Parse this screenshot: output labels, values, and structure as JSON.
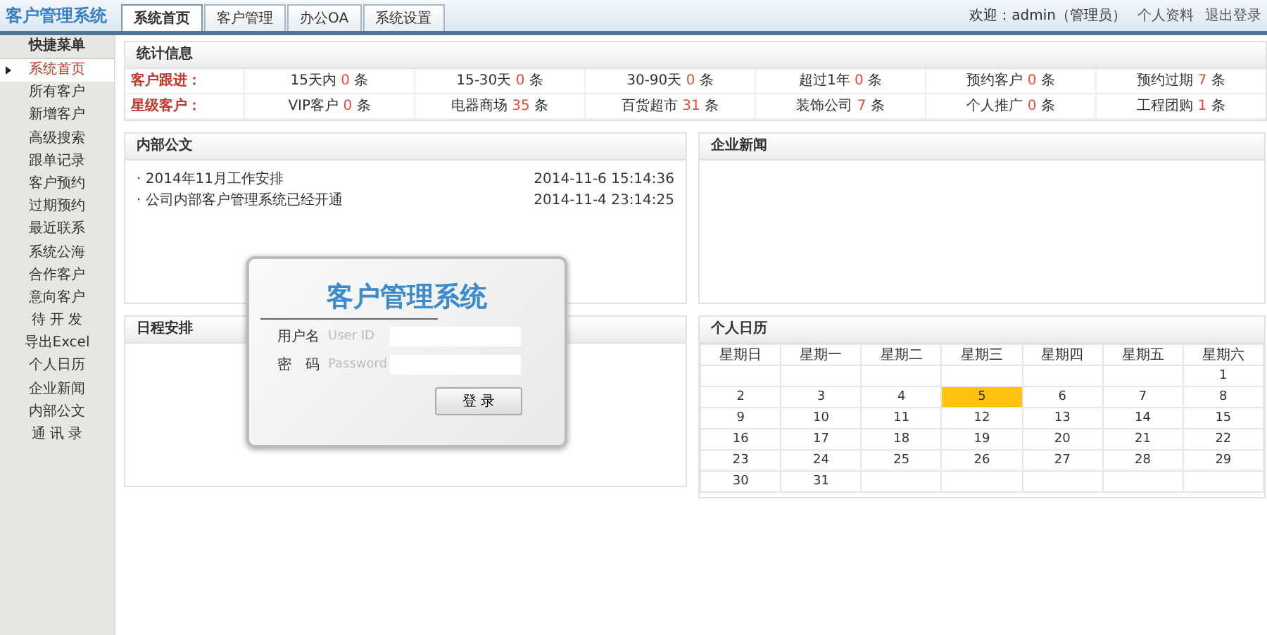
{
  "header": {
    "logo": "客户管理系统",
    "tabs": [
      {
        "label": "系统首页",
        "selected": true
      },
      {
        "label": "客户管理",
        "selected": false
      },
      {
        "label": "办公OA",
        "selected": false
      },
      {
        "label": "系统设置",
        "selected": false
      }
    ],
    "welcome": "欢迎：admin（管理员）",
    "links": [
      "个人资料",
      "退出登录"
    ]
  },
  "sidebar": {
    "title": "快捷菜单",
    "items": [
      {
        "label": "系统首页",
        "selected": true
      },
      {
        "label": "所有客户",
        "selected": false
      },
      {
        "label": "新增客户",
        "selected": false
      },
      {
        "label": "高级搜索",
        "selected": false
      },
      {
        "label": "跟单记录",
        "selected": false
      },
      {
        "label": "客户预约",
        "selected": false
      },
      {
        "label": "过期预约",
        "selected": false
      },
      {
        "label": "最近联系",
        "selected": false
      },
      {
        "label": "系统公海",
        "selected": false
      },
      {
        "label": "合作客户",
        "selected": false
      },
      {
        "label": "意向客户",
        "selected": false
      },
      {
        "label": "待 开 发",
        "selected": false
      },
      {
        "label": "导出Excel",
        "selected": false
      },
      {
        "label": "个人日历",
        "selected": false
      },
      {
        "label": "企业新闻",
        "selected": false
      },
      {
        "label": "内部公文",
        "selected": false
      },
      {
        "label": "通 讯 录",
        "selected": false
      }
    ]
  },
  "stats": {
    "title": "统计信息",
    "rows": [
      {
        "label": "客户跟进：",
        "cells": [
          {
            "label": "15天内",
            "count": "0",
            "unit": "条"
          },
          {
            "label": "15-30天",
            "count": "0",
            "unit": "条"
          },
          {
            "label": "30-90天",
            "count": "0",
            "unit": "条"
          },
          {
            "label": "超过1年",
            "count": "0",
            "unit": "条"
          },
          {
            "label": "预约客户",
            "count": "0",
            "unit": "条"
          },
          {
            "label": "预约过期",
            "count": "7",
            "unit": "条"
          }
        ]
      },
      {
        "label": "星级客户：",
        "cells": [
          {
            "label": "VIP客户",
            "count": "0",
            "unit": "条"
          },
          {
            "label": "电器商场",
            "count": "35",
            "unit": "条"
          },
          {
            "label": "百货超市",
            "count": "31",
            "unit": "条"
          },
          {
            "label": "装饰公司",
            "count": "7",
            "unit": "条"
          },
          {
            "label": "个人推广",
            "count": "0",
            "unit": "条"
          },
          {
            "label": "工程团购",
            "count": "1",
            "unit": "条"
          }
        ]
      }
    ]
  },
  "notices": {
    "title": "内部公文",
    "items": [
      {
        "title": "· 2014年11月工作安排",
        "time": "2014-11-6 15:14:36"
      },
      {
        "title": "· 公司内部客户管理系统已经开通",
        "time": "2014-11-4 23:14:25"
      }
    ]
  },
  "news": {
    "title": "企业新闻"
  },
  "schedule": {
    "title": "日程安排"
  },
  "calendar": {
    "title": "个人日历",
    "weekdays": [
      "星期日",
      "星期一",
      "星期二",
      "星期三",
      "星期四",
      "星期五",
      "星期六"
    ],
    "weeks": [
      [
        {
          "kind": "blank"
        },
        {
          "kind": "blank"
        },
        {
          "kind": "blank"
        },
        {
          "kind": "blank"
        },
        {
          "kind": "blank"
        },
        {
          "kind": "blank"
        },
        {
          "day": "1",
          "selected": false
        }
      ],
      [
        {
          "day": "2",
          "selected": false
        },
        {
          "day": "3",
          "selected": false
        },
        {
          "day": "4",
          "selected": false
        },
        {
          "day": "5",
          "selected": true
        },
        {
          "day": "6",
          "selected": false
        },
        {
          "day": "7",
          "selected": false
        },
        {
          "day": "8",
          "selected": false
        }
      ],
      [
        {
          "day": "9",
          "selected": false
        },
        {
          "day": "10",
          "selected": false
        },
        {
          "day": "11",
          "selected": false
        },
        {
          "day": "12",
          "selected": false
        },
        {
          "day": "13",
          "selected": false
        },
        {
          "day": "14",
          "selected": false
        },
        {
          "day": "15",
          "selected": false
        }
      ],
      [
        {
          "day": "16",
          "selected": false
        },
        {
          "day": "17",
          "selected": false
        },
        {
          "day": "18",
          "selected": false
        },
        {
          "day": "19",
          "selected": false
        },
        {
          "day": "20",
          "selected": false
        },
        {
          "day": "21",
          "selected": false
        },
        {
          "day": "22",
          "selected": false
        }
      ],
      [
        {
          "day": "23",
          "selected": false
        },
        {
          "day": "24",
          "selected": false
        },
        {
          "day": "25",
          "selected": false
        },
        {
          "day": "26",
          "selected": false
        },
        {
          "day": "27",
          "selected": false
        },
        {
          "day": "28",
          "selected": false
        },
        {
          "day": "29",
          "selected": false
        }
      ],
      [
        {
          "day": "30",
          "selected": false
        },
        {
          "day": "31",
          "selected": false
        },
        {
          "kind": "blank"
        },
        {
          "kind": "blank"
        },
        {
          "kind": "blank"
        },
        {
          "kind": "blank"
        },
        {
          "kind": "blank"
        }
      ]
    ]
  },
  "login_dialog": {
    "title": "客户管理系统",
    "fields": [
      {
        "label": "用户名",
        "placeholder": "User ID"
      },
      {
        "label": "密　码",
        "placeholder": "Password"
      }
    ],
    "button": "登 录"
  }
}
